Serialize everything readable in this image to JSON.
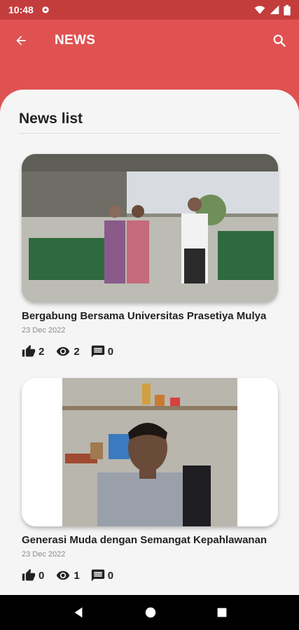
{
  "status_bar": {
    "time": "10:48"
  },
  "app_bar": {
    "title": "NEWS"
  },
  "section": {
    "title": "News list"
  },
  "news": [
    {
      "title": "Bergabung Bersama Universitas Prasetiya Mulya",
      "date": "23 Dec 2022",
      "likes": "2",
      "views": "2",
      "comments": "0"
    },
    {
      "title": "Generasi Muda dengan Semangat Kepahlawanan",
      "date": "23 Dec 2022",
      "likes": "0",
      "views": "1",
      "comments": "0"
    }
  ],
  "colors": {
    "primary": "#e05252",
    "status_bar": "#c43d3d",
    "background": "#f5f5f5"
  },
  "icons": {
    "back": "arrow-left",
    "search": "magnifier",
    "like": "thumb-up",
    "views": "eye",
    "comments": "chat-bubble"
  }
}
